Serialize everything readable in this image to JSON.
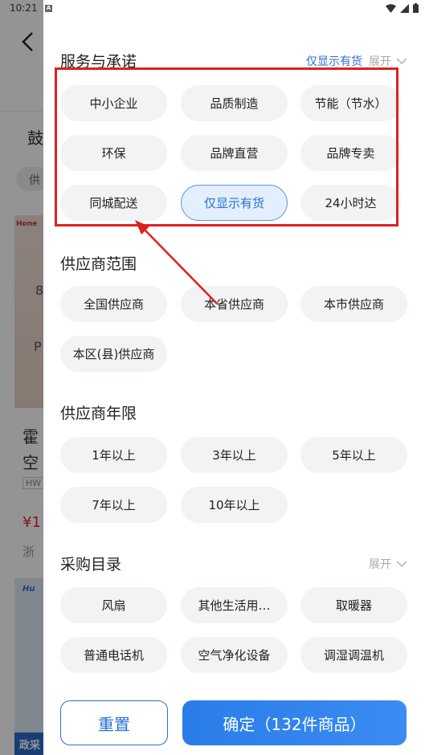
{
  "status_bar": {
    "time": "10:21",
    "a_icon": "A"
  },
  "background": {
    "heading_char": "鼓",
    "tag_char": "供",
    "brand": "Hone",
    "img_char_1": "8",
    "img_char_2": "P",
    "title_line_1": "霍",
    "title_line_2": "空",
    "model_tag": "HW",
    "price": "¥1",
    "location": "浙",
    "brand2": "Hu",
    "gov_badge": "政采"
  },
  "filter": {
    "service": {
      "title": "服务与承诺",
      "only_in_stock_link": "仅显示有货",
      "expand_label": "展开",
      "chips": [
        {
          "label": "中小企业",
          "selected": false
        },
        {
          "label": "品质制造",
          "selected": false
        },
        {
          "label": "节能（节水）",
          "selected": false
        },
        {
          "label": "环保",
          "selected": false
        },
        {
          "label": "品牌直营",
          "selected": false
        },
        {
          "label": "品牌专卖",
          "selected": false
        },
        {
          "label": "同城配送",
          "selected": false
        },
        {
          "label": "仅显示有货",
          "selected": true
        },
        {
          "label": "24小时达",
          "selected": false
        }
      ]
    },
    "supplier_scope": {
      "title": "供应商范围",
      "chips": [
        "全国供应商",
        "本省供应商",
        "本市供应商",
        "本区(县)供应商"
      ]
    },
    "supplier_years": {
      "title": "供应商年限",
      "chips": [
        "1年以上",
        "3年以上",
        "5年以上",
        "7年以上",
        "10年以上"
      ]
    },
    "catalog": {
      "title": "采购目录",
      "expand_label": "展开",
      "chips": [
        "风扇",
        "其他生活用…",
        "取暖器",
        "普通电话机",
        "空气净化设备",
        "调湿调温机"
      ]
    }
  },
  "actions": {
    "reset_label": "重置",
    "confirm_label": "确定（132件商品）"
  },
  "colors": {
    "accent": "#2a6fd6",
    "annotation": "#e02020",
    "chip_bg": "#f2f3f5",
    "selected_chip_bg": "#e3effd"
  }
}
